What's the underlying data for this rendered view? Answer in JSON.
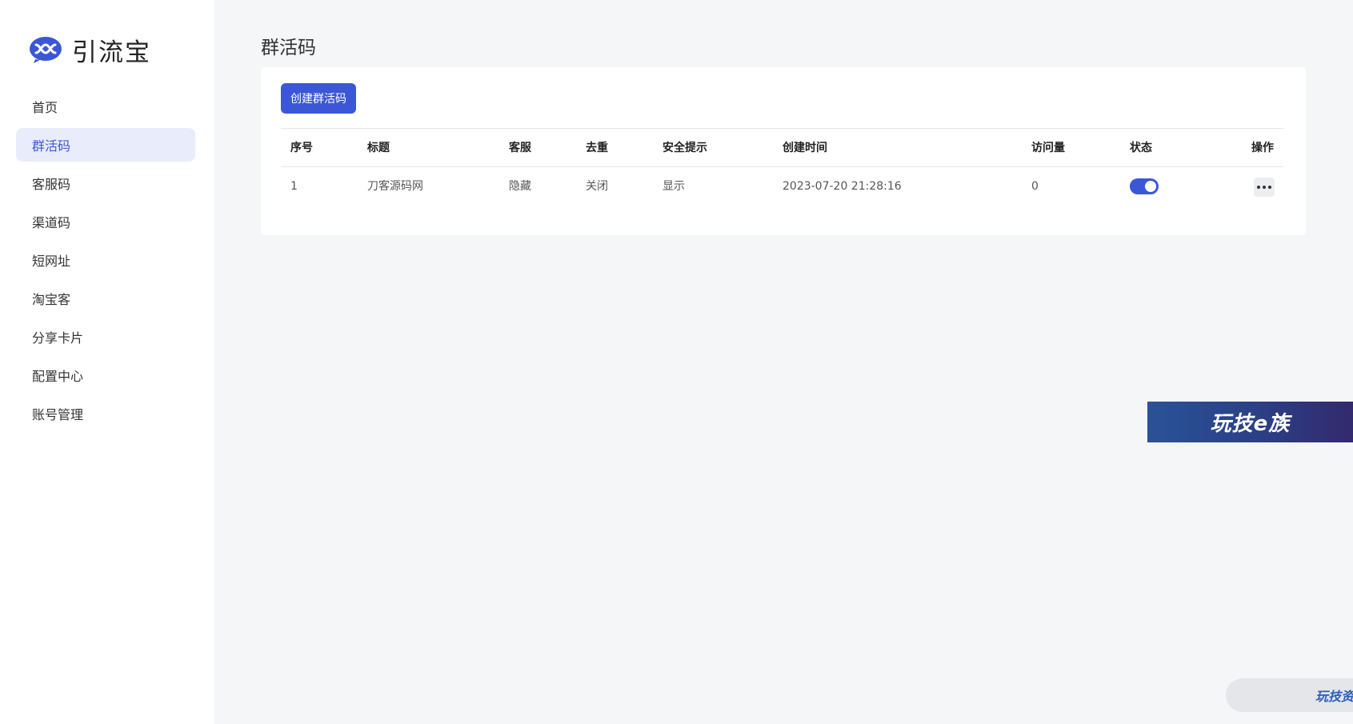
{
  "app": {
    "name": "引流宝",
    "brand_color": "#3b57d8"
  },
  "sidebar": {
    "items": [
      {
        "label": "首页",
        "active": false
      },
      {
        "label": "群活码",
        "active": true
      },
      {
        "label": "客服码",
        "active": false
      },
      {
        "label": "渠道码",
        "active": false
      },
      {
        "label": "短网址",
        "active": false
      },
      {
        "label": "淘宝客",
        "active": false
      },
      {
        "label": "分享卡片",
        "active": false
      },
      {
        "label": "配置中心",
        "active": false
      },
      {
        "label": "账号管理",
        "active": false
      }
    ]
  },
  "main": {
    "title": "群活码",
    "create_button": "创建群活码",
    "table": {
      "headers": [
        "序号",
        "标题",
        "客服",
        "去重",
        "安全提示",
        "创建时间",
        "访问量",
        "状态",
        "操作"
      ],
      "rows": [
        {
          "index": "1",
          "title": "刀客源码网",
          "service": "隐藏",
          "dedup": "关闭",
          "safety": "显示",
          "created": "2023-07-20 21:28:16",
          "visits": "0",
          "status_on": true
        }
      ]
    }
  },
  "overlays": {
    "banner_text": "玩技e族",
    "corner_text": "玩技资源"
  }
}
